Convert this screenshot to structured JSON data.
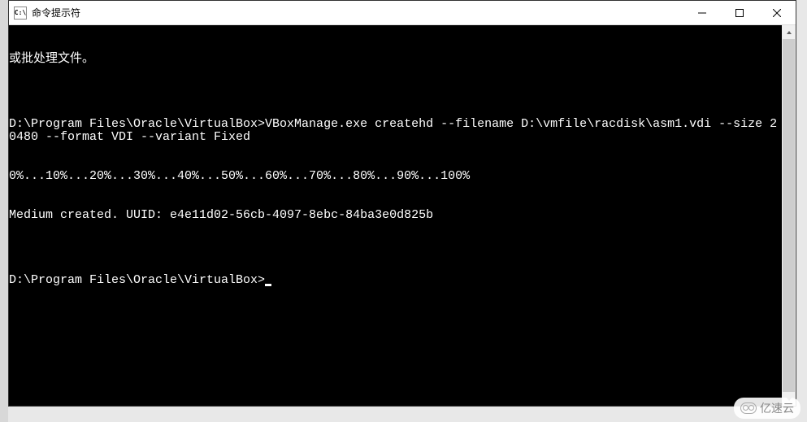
{
  "window": {
    "title": "命令提示符",
    "icon_label": "C:\\"
  },
  "terminal": {
    "line1": "或批处理文件。",
    "blank1": "",
    "line2": "D:\\Program Files\\Oracle\\VirtualBox>VBoxManage.exe createhd --filename D:\\vmfile\\racdisk\\asm1.vdi --size 20480 --format VDI --variant Fixed",
    "line3": "0%...10%...20%...30%...40%...50%...60%...70%...80%...90%...100%",
    "line4": "Medium created. UUID: e4e11d02-56cb-4097-8ebc-84ba3e0d825b",
    "blank2": "",
    "prompt": "D:\\Program Files\\Oracle\\VirtualBox>"
  },
  "watermark": {
    "text": "亿速云"
  }
}
